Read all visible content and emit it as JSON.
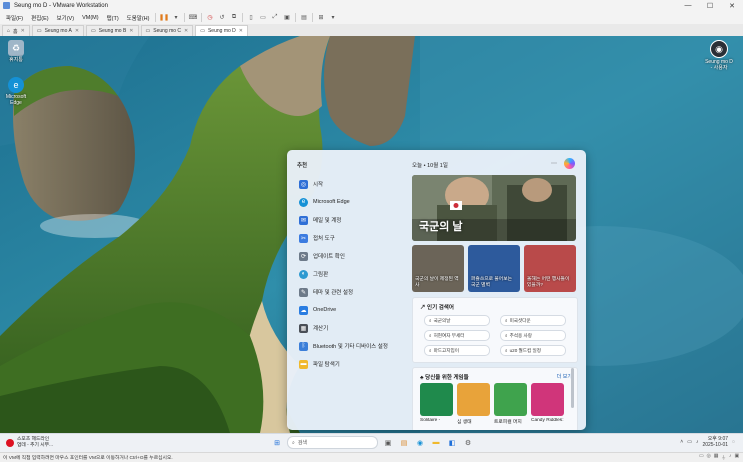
{
  "window": {
    "title": "Seung mo D - VMware Workstation",
    "controls": [
      "—",
      "☐",
      "✕"
    ]
  },
  "menubar": {
    "items": [
      "파일(F)",
      "편집(E)",
      "보기(V)",
      "VM(M)",
      "탭(T)",
      "도움말(H)"
    ]
  },
  "tabs": [
    {
      "label": "홈",
      "active": false
    },
    {
      "label": "Seung mo A",
      "active": false
    },
    {
      "label": "Seung mo B",
      "active": false
    },
    {
      "label": "Seung mo C",
      "active": false
    },
    {
      "label": "Seung mo D",
      "active": true
    }
  ],
  "desktop_icons": {
    "recycle_bin": "휴지통",
    "edge": "Microsoft Edge",
    "user": "Seung mo D - 사용자"
  },
  "start_menu": {
    "recommended_label": "추천",
    "apps": [
      {
        "label": "시작",
        "icon": "start-icon",
        "color": "#2f6fd6"
      },
      {
        "label": "Microsoft Edge",
        "icon": "edge-icon",
        "color": "#1591d6"
      },
      {
        "label": "메일 및 계정",
        "icon": "mail-icon",
        "color": "#2f6fd6"
      },
      {
        "label": "접처 도구",
        "icon": "snip-icon",
        "color": "#3b7be0"
      },
      {
        "label": "업데이트 확인",
        "icon": "update-icon",
        "color": "#6d7a89"
      },
      {
        "label": "그림판",
        "icon": "paint-icon",
        "color": "#2e9ad1"
      },
      {
        "label": "테마 및 관련 설정",
        "icon": "brush-icon",
        "color": "#6d7a89"
      },
      {
        "label": "OneDrive",
        "icon": "onedrive-icon",
        "color": "#2a7de1"
      },
      {
        "label": "계산기",
        "icon": "calculator-icon",
        "color": "#4a4f57"
      },
      {
        "label": "Bluetooth 및 기타 디바이스 설정",
        "icon": "bluetooth-icon",
        "color": "#3c7fd9"
      },
      {
        "label": "파일 탐색기",
        "icon": "folder-icon",
        "color": "#f0b92d"
      }
    ],
    "feed_header": "오늘 • 10월 1일",
    "hero_title": "국군의 날",
    "cards": [
      {
        "title": "국군의 날이 제정된 역사"
      },
      {
        "title": "퍼즐쓰으로 풀어보는 국군 별벽"
      },
      {
        "title": "올해는 어떤 행사들이 있을까?"
      }
    ],
    "trending_header": "인기 검색어",
    "trending": [
      "국군의날",
      "미국셧다운",
      "허현여자 부세터",
      "추석용 사랑",
      "마드고지입이",
      "u20 월드컵 일정"
    ],
    "games_header": "당신을 위한 게임들",
    "games_more": "더 보기",
    "games": [
      {
        "label": "Solitaire -",
        "color": "#1f8a4c"
      },
      {
        "label": "심 생태",
        "color": "#e8a33a"
      },
      {
        "label": "트로피컬 머지",
        "color": "#3fa34d"
      },
      {
        "label": "Candy Riddles:",
        "color": "#d0357a"
      }
    ]
  },
  "taskbar": {
    "weather_line1": "스포츠 헤드라인",
    "weather_line2": "업데 - 추기 시부...",
    "search_placeholder": "검색",
    "time": "오후 9:07",
    "date": "2025-10-01"
  },
  "statusbar": {
    "text": "이 VM에 직접 입력하려면 마우스 포인터를 VM으로 이동하거나 Ctrl+G를 누르십시오."
  }
}
